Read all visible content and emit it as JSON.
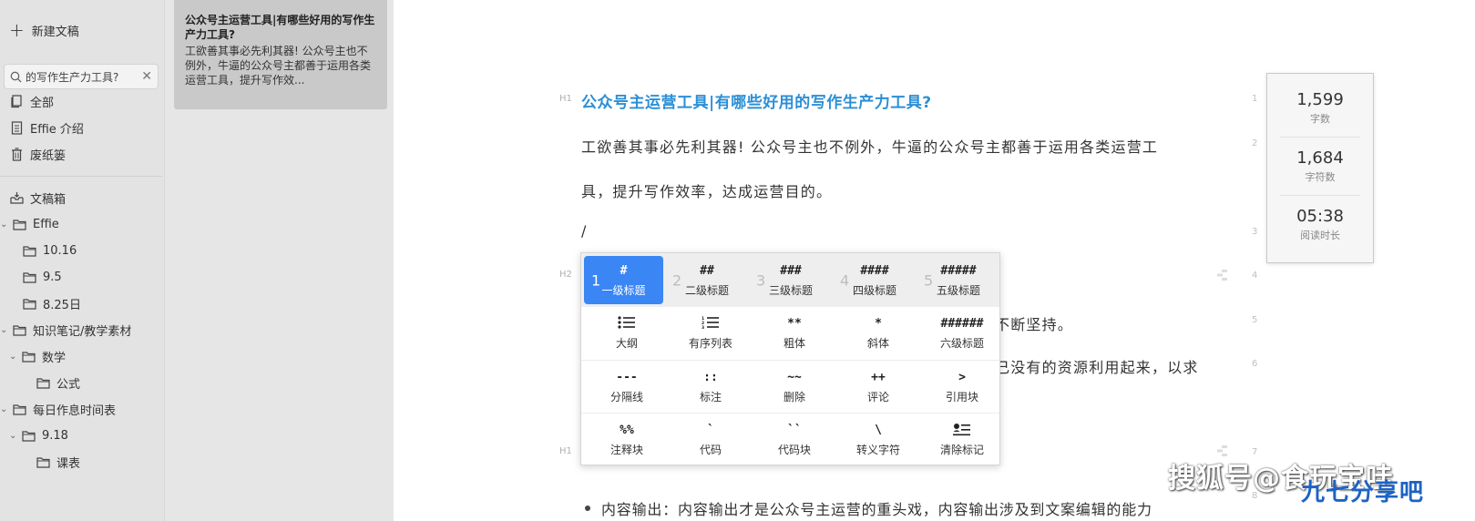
{
  "sidebar": {
    "new_doc_label": "新建文稿",
    "search": {
      "value": "的写作生产力工具?",
      "placeholder": ""
    },
    "items": [
      {
        "label": "全部",
        "icon": "documents-icon"
      },
      {
        "label": "Effie 介绍",
        "icon": "document-icon"
      },
      {
        "label": "废纸篓",
        "icon": "trash-icon"
      },
      {
        "label": "文稿箱",
        "icon": "inbox-icon"
      },
      {
        "label": "Effie",
        "icon": "folder-icon"
      },
      {
        "label": "10.16",
        "icon": "folder-icon"
      },
      {
        "label": "9.5",
        "icon": "folder-icon"
      },
      {
        "label": "8.25日",
        "icon": "folder-icon"
      },
      {
        "label": "知识笔记/教学素材",
        "icon": "folder-icon"
      },
      {
        "label": "数学",
        "icon": "folder-icon"
      },
      {
        "label": "公式",
        "icon": "folder-icon"
      },
      {
        "label": "每日作息时间表",
        "icon": "folder-icon"
      },
      {
        "label": "9.18",
        "icon": "folder-icon"
      },
      {
        "label": "课表",
        "icon": "folder-icon"
      }
    ]
  },
  "doclist": {
    "card": {
      "title": "公众号主运营工具|有哪些好用的写作生产力工具?",
      "preview": "工欲善其事必先利其器! 公众号主也不例外，牛逼的公众号主都善于运用各类运营工具，提升写作效..."
    }
  },
  "editor": {
    "h1_label": "H1",
    "h2_label": "H2",
    "title": "公众号主运营工具|有哪些好用的写作生产力工具?",
    "para1_line1": "工欲善其事必先利其器! 公众号主也不例外，牛逼的公众号主都善于运用各类运营工",
    "para1_line2": "具，提升写作效率，达成运营目的。",
    "slash": "/",
    "partial1": "不断坚持。",
    "partial2": "己没有的资源利用起来，以求",
    "bullet1": "内容输出：内容输出才是公众号主运营的重头戏，内容输出涉及到文案编辑的能力",
    "line_numbers": [
      "1",
      "2",
      "3",
      "4",
      "5",
      "6",
      "7",
      "8"
    ]
  },
  "stats": {
    "words": {
      "value": "1,599",
      "label": "字数"
    },
    "chars": {
      "value": "1,684",
      "label": "字符数"
    },
    "reading": {
      "value": "05:38",
      "label": "阅读时长"
    }
  },
  "popup": {
    "rows": [
      [
        {
          "num": "1",
          "sym": "#",
          "label": "一级标题"
        },
        {
          "num": "2",
          "sym": "##",
          "label": "二级标题"
        },
        {
          "num": "3",
          "sym": "###",
          "label": "三级标题"
        },
        {
          "num": "4",
          "sym": "####",
          "label": "四级标题"
        },
        {
          "num": "5",
          "sym": "#####",
          "label": "五级标题"
        }
      ],
      [
        {
          "sym": "⋮☰",
          "label": "大纲"
        },
        {
          "sym": "⋮☰",
          "label": "有序列表"
        },
        {
          "sym": "**",
          "label": "粗体"
        },
        {
          "sym": "*",
          "label": "斜体"
        },
        {
          "sym": "######",
          "label": "六级标题"
        }
      ],
      [
        {
          "sym": "---",
          "label": "分隔线"
        },
        {
          "sym": "::",
          "label": "标注"
        },
        {
          "sym": "~~",
          "label": "删除"
        },
        {
          "sym": "++",
          "label": "评论"
        },
        {
          "sym": ">",
          "label": "引用块"
        }
      ],
      [
        {
          "sym": "%%",
          "label": "注释块"
        },
        {
          "sym": "`",
          "label": "代码"
        },
        {
          "sym": "``",
          "label": "代码块"
        },
        {
          "sym": "\\",
          "label": "转义字符"
        },
        {
          "sym": "⊟",
          "label": "清除标记"
        }
      ]
    ]
  },
  "watermark": {
    "sohu": "搜狐号@食玩宝哇",
    "site": "九七分享吧"
  },
  "colors": {
    "accent": "#3a86f5",
    "title": "#2c8fd6",
    "sidebar_bg": "#e3e3e3",
    "selected_card": "#c9c9c9"
  }
}
